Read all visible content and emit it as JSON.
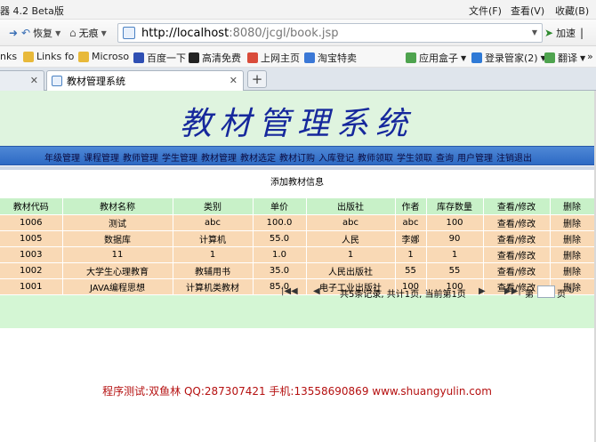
{
  "titlebar": {
    "app_title": "器 4.2 Beta版",
    "menus": [
      "文件(F)",
      "查看(V)",
      "收藏(B)"
    ]
  },
  "nav": {
    "forward_label": "",
    "restore_label": "恢复",
    "nocache_label": "无痕",
    "url_host": "http://localhost",
    "url_rest": ":8080/jcgl/book.jsp",
    "accelerate_label": "加速"
  },
  "bookmarks": [
    "nks",
    "Links fo",
    "Microso",
    "百度一下",
    "高清免费",
    "上网主页",
    "淘宝特卖",
    "应用盒子",
    "登录管家(2)",
    "翻译"
  ],
  "tabs": [
    {
      "label": "",
      "active": false
    },
    {
      "label": "教材管理系统",
      "active": true
    }
  ],
  "page": {
    "system_title": "教材管理系统",
    "nav_links": [
      "年级管理",
      "课程管理",
      "教师管理",
      "学生管理",
      "教材管理",
      "教材选定",
      "教材订购",
      "入库登记",
      "教师领取",
      "学生领取",
      "查询",
      "用户管理",
      "注销退出"
    ],
    "add_label": "添加教材信息",
    "table": {
      "headers": [
        "教材代码",
        "教材名称",
        "类别",
        "单价",
        "出版社",
        "作者",
        "库存数量",
        "查看/修改",
        "删除"
      ],
      "rows": [
        [
          "1006",
          "测试",
          "abc",
          "100.0",
          "abc",
          "abc",
          "100",
          "查看/修改",
          "删除"
        ],
        [
          "1005",
          "数据库",
          "计算机",
          "55.0",
          "人民",
          "李娜",
          "90",
          "查看/修改",
          "删除"
        ],
        [
          "1003",
          "11",
          "1",
          "1.0",
          "1",
          "1",
          "1",
          "查看/修改",
          "删除"
        ],
        [
          "1002",
          "大学生心理教育",
          "教辅用书",
          "35.0",
          "人民出版社",
          "55",
          "55",
          "查看/修改",
          "删除"
        ],
        [
          "1001",
          "JAVA编程思想",
          "计算机类教材",
          "85.0",
          "电子工业出版社",
          "100",
          "100",
          "查看/修改",
          "删除"
        ]
      ]
    },
    "pager": {
      "summary": "共5条记录, 共计1页, 当前第1页",
      "goto_prefix": "第",
      "goto_suffix": "页"
    },
    "footer": "程序测试:双鱼林  QQ:287307421  手机:13558690869 www.shuangyulin.com"
  }
}
